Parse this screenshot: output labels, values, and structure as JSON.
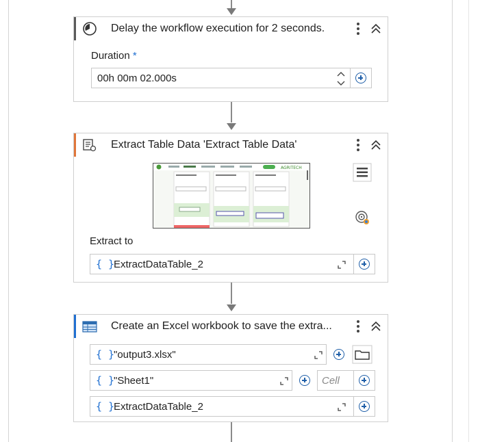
{
  "delay_activity": {
    "title": "Delay the workflow execution for 2 seconds.",
    "duration_label": "Duration",
    "required_mark": "*",
    "duration_value": "00h 00m 02.000s",
    "accent_color": "#5a5a5a"
  },
  "extract_activity": {
    "title": "Extract Table Data 'Extract Table Data'",
    "extract_to_label": "Extract to",
    "extract_to_value": "ExtractDataTable_2",
    "accent_color": "#e0763a",
    "thumb_logo_text": "AGRITECH"
  },
  "excel_activity": {
    "title": "Create an Excel workbook to save the extra...",
    "file_value": "\"output3.xlsx\"",
    "sheet_value": "\"Sheet1\"",
    "cell_placeholder": "Cell",
    "data_value": "ExtractDataTable_2",
    "accent_color": "#1f6fd1"
  },
  "icons": {
    "brace_symbol": "{ }"
  }
}
